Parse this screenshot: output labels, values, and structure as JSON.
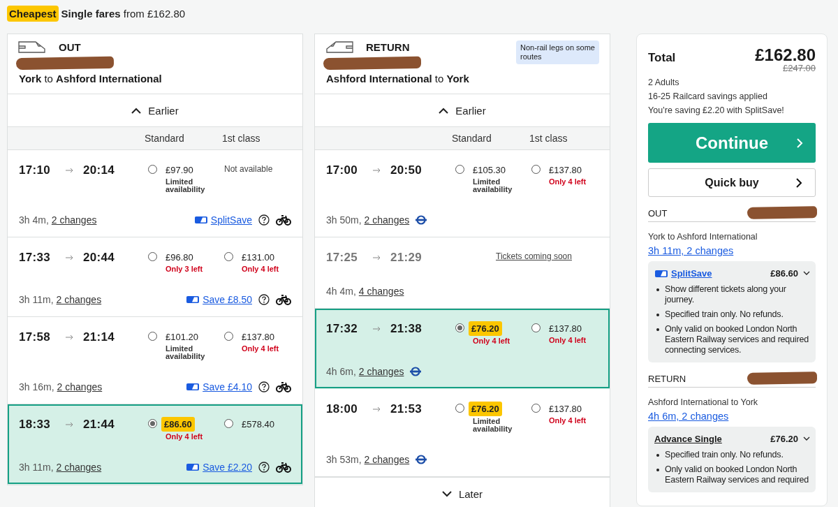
{
  "header": {
    "badge": "Cheapest",
    "title": "**Single fares** from £162.80"
  },
  "journeys": [
    {
      "kind": "out",
      "label": "OUT",
      "route": "**York** to **Ashford International**",
      "earlier": "Earlier",
      "columns": [
        "Standard",
        "1st class"
      ],
      "trains": [
        {
          "depart": "17:10",
          "arrive": "20:14",
          "duration": "3h 4m,",
          "changes": "2 changes",
          "selected": false,
          "disabled": false,
          "saving": "SplitSave",
          "help": true,
          "bike": true,
          "fares": [
            {
              "kind": "fare",
              "price": "£97.90",
              "note": "Limited availability",
              "urgent": false,
              "selected": false,
              "cheapest": false
            },
            {
              "kind": "unavailable",
              "text": "Not available"
            }
          ]
        },
        {
          "depart": "17:33",
          "arrive": "20:44",
          "duration": "3h 11m,",
          "changes": "2 changes",
          "selected": false,
          "disabled": false,
          "saving": "Save £8.50",
          "help": true,
          "bike": true,
          "fares": [
            {
              "kind": "fare",
              "price": "£96.80",
              "note": "Only 3 left",
              "urgent": true,
              "selected": false,
              "cheapest": false
            },
            {
              "kind": "fare",
              "price": "£131.00",
              "note": "Only 4 left",
              "urgent": true,
              "selected": false,
              "cheapest": false
            }
          ]
        },
        {
          "depart": "17:58",
          "arrive": "21:14",
          "duration": "3h 16m,",
          "changes": "2 changes",
          "selected": false,
          "disabled": false,
          "saving": "Save £4.10",
          "help": true,
          "bike": true,
          "fares": [
            {
              "kind": "fare",
              "price": "£101.20",
              "note": "Limited availability",
              "urgent": false,
              "selected": false,
              "cheapest": false
            },
            {
              "kind": "fare",
              "price": "£137.80",
              "note": "Only 4 left",
              "urgent": true,
              "selected": false,
              "cheapest": false
            }
          ]
        },
        {
          "depart": "18:33",
          "arrive": "21:44",
          "duration": "3h 11m,",
          "changes": "2 changes",
          "selected": true,
          "disabled": false,
          "saving": "Save £2.20",
          "help": true,
          "bike": true,
          "fares": [
            {
              "kind": "fare",
              "price": "£86.60",
              "note": "Only 4 left",
              "urgent": true,
              "selected": true,
              "cheapest": true
            },
            {
              "kind": "fare",
              "price": "£578.40",
              "selected": false,
              "cheapest": false
            }
          ]
        }
      ]
    },
    {
      "kind": "return",
      "label": "RETURN",
      "note": "Non-rail legs on some routes",
      "route": "**Ashford International** to **York**",
      "earlier": "Earlier",
      "later": "Later",
      "columns": [
        "Standard",
        "1st class"
      ],
      "trains": [
        {
          "depart": "17:00",
          "arrive": "20:50",
          "duration": "3h 50m,",
          "changes": "2 changes",
          "selected": false,
          "disabled": false,
          "tube": true,
          "fares": [
            {
              "kind": "fare",
              "price": "£105.30",
              "note": "Limited availability",
              "urgent": false,
              "selected": false,
              "cheapest": false
            },
            {
              "kind": "fare",
              "price": "£137.80",
              "note": "Only 4 left",
              "urgent": true,
              "selected": false,
              "cheapest": false
            }
          ]
        },
        {
          "depart": "17:25",
          "arrive": "21:29",
          "duration": "4h 4m,",
          "changes": "4 changes",
          "selected": false,
          "disabled": true,
          "fares": [
            {
              "kind": "soon",
              "text": "Tickets coming soon"
            }
          ]
        },
        {
          "depart": "17:32",
          "arrive": "21:38",
          "duration": "4h 6m,",
          "changes": "2 changes",
          "selected": true,
          "disabled": false,
          "tube": true,
          "fares": [
            {
              "kind": "fare",
              "price": "£76.20",
              "note": "Only 4 left",
              "urgent": true,
              "selected": true,
              "cheapest": true
            },
            {
              "kind": "fare",
              "price": "£137.80",
              "note": "Only 4 left",
              "urgent": true,
              "selected": false,
              "cheapest": false
            }
          ]
        },
        {
          "depart": "18:00",
          "arrive": "21:53",
          "duration": "3h 53m,",
          "changes": "2 changes",
          "selected": false,
          "disabled": false,
          "tube": true,
          "fares": [
            {
              "kind": "fare",
              "price": "£76.20",
              "note": "Limited availability",
              "urgent": false,
              "selected": false,
              "cheapest": true
            },
            {
              "kind": "fare",
              "price": "£137.80",
              "note": "Only 4 left",
              "urgent": true,
              "selected": false,
              "cheapest": false
            }
          ]
        }
      ]
    }
  ],
  "summary": {
    "label": "Total",
    "total": "£162.80",
    "was": "£247.00",
    "lines": [
      "2 Adults",
      "16-25 Railcard savings applied",
      "You’re saving £2.20 with SplitSave!"
    ],
    "buttons": [
      {
        "kind": "primary",
        "label": "Continue"
      },
      {
        "kind": "secondary",
        "label": "Quick buy"
      }
    ],
    "legs": [
      {
        "label": "OUT",
        "route": "York to Ashford International",
        "journey": "3h 11m, 2 changes",
        "ticket": {
          "kind": "splitsave",
          "name": "SplitSave",
          "price": "£86.60",
          "terms": [
            "Show different tickets along your journey.",
            "Specified train only. No refunds.",
            "Only valid on booked London North Eastern Railway services and required connecting services."
          ]
        }
      },
      {
        "label": "RETURN",
        "route": "Ashford International to York",
        "journey": "4h 6m, 2 changes",
        "ticket": {
          "kind": "standard",
          "name": "Advance Single",
          "price": "£76.20",
          "terms": [
            "Specified train only. No refunds.",
            "Only valid on booked London North Eastern Railway services and required"
          ]
        }
      }
    ]
  }
}
